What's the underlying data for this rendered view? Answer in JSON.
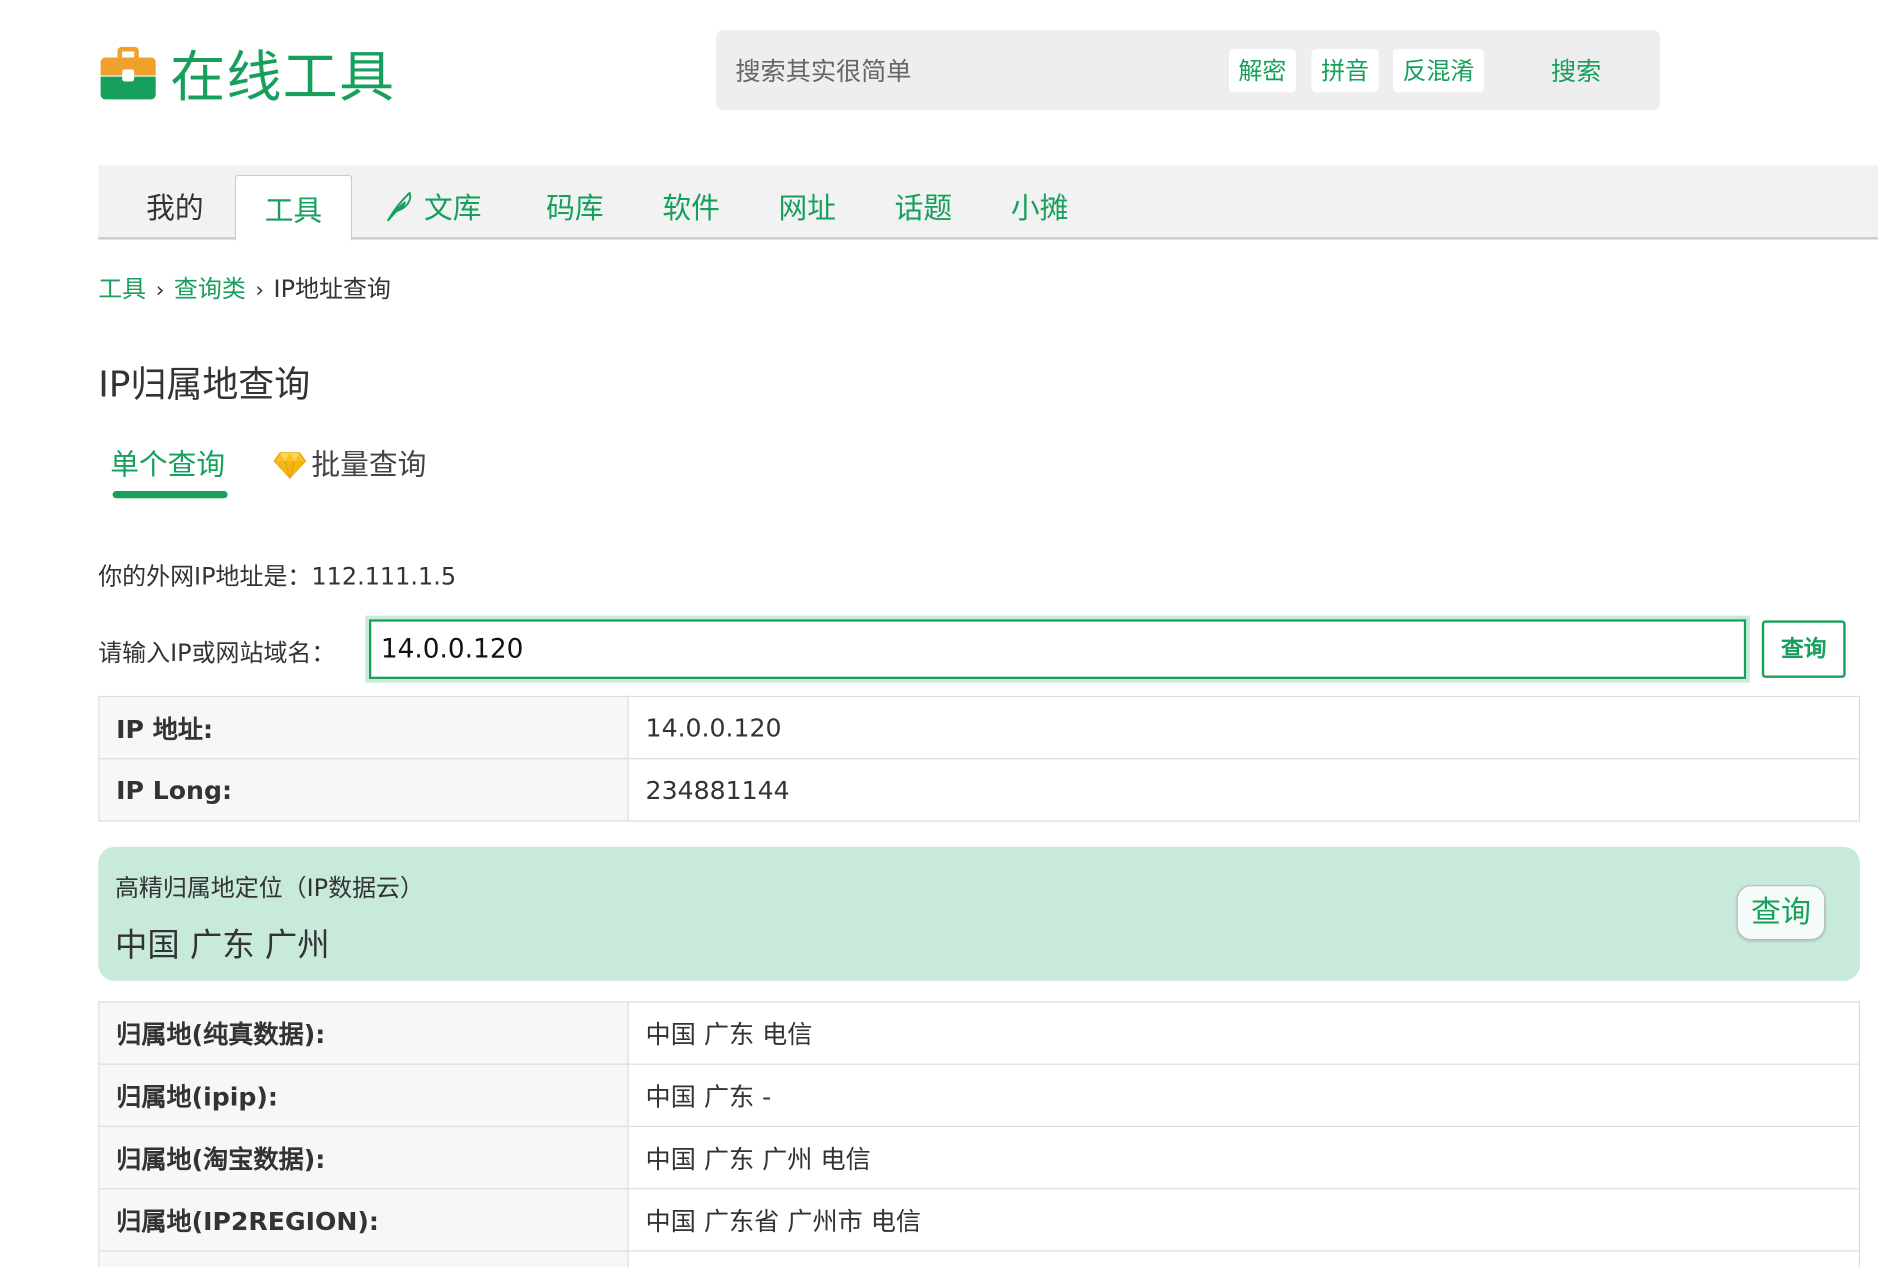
{
  "header": {
    "logo_text": "在线工具",
    "logo_icon": "briefcase-icon",
    "search": {
      "placeholder": "搜索其实很简单",
      "quick_links": [
        "解密",
        "拼音",
        "反混淆"
      ],
      "button_label": "搜索"
    }
  },
  "nav": {
    "items": [
      "我的",
      "工具",
      "文库",
      "码库",
      "软件",
      "网址",
      "话题",
      "小摊"
    ],
    "active": "工具",
    "icon_before_wenku": "feather-icon"
  },
  "breadcrumb": {
    "items": [
      "工具",
      "查询类",
      "IP地址查询"
    ],
    "separator": "›"
  },
  "page_title": "IP归属地查询",
  "subtabs": {
    "single": "单个查询",
    "batch": "批量查询",
    "batch_icon": "diamond-icon"
  },
  "my_ip": {
    "text": "你的外网IP地址是：112.111.1.5"
  },
  "query": {
    "label": "请输入IP或网站域名：",
    "value": "14.0.0.120",
    "button_label": "查询"
  },
  "basic_info": [
    {
      "key": "IP 地址:",
      "value": "14.0.0.120"
    },
    {
      "key": "IP Long:",
      "value": "234881144"
    }
  ],
  "geo_card": {
    "label": "高精归属地定位（IP数据云）",
    "value": "中国 广东 广州",
    "button_label": "查询"
  },
  "sources": [
    {
      "key": "归属地(纯真数据):",
      "value": "中国 广东 电信"
    },
    {
      "key": "归属地(ipip):",
      "value": "中国 广东 -"
    },
    {
      "key": "归属地(淘宝数据):",
      "value": "中国 广东 广州 电信"
    },
    {
      "key": "归属地(IP2REGION):",
      "value": "中国 广东省 广州市 电信"
    }
  ],
  "colors": {
    "brand_green": "#16a05c",
    "card_bg": "#c8eadb",
    "logo_orange": "#f0a02c"
  }
}
